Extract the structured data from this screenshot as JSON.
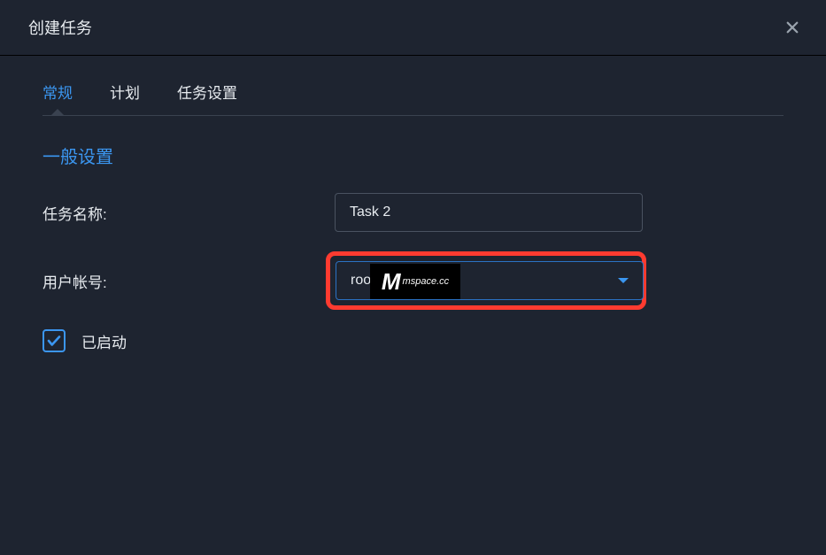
{
  "dialog": {
    "title": "创建任务"
  },
  "tabs": {
    "general": "常规",
    "schedule": "计划",
    "taskSettings": "任务设置"
  },
  "section": {
    "generalSettings": "一般设置"
  },
  "form": {
    "taskNameLabel": "任务名称:",
    "taskNameValue": "Task 2",
    "userAccountLabel": "用户帐号:",
    "userAccountValue": "root",
    "enabledLabel": "已启动"
  },
  "watermark": {
    "text": "mspace.cc"
  }
}
